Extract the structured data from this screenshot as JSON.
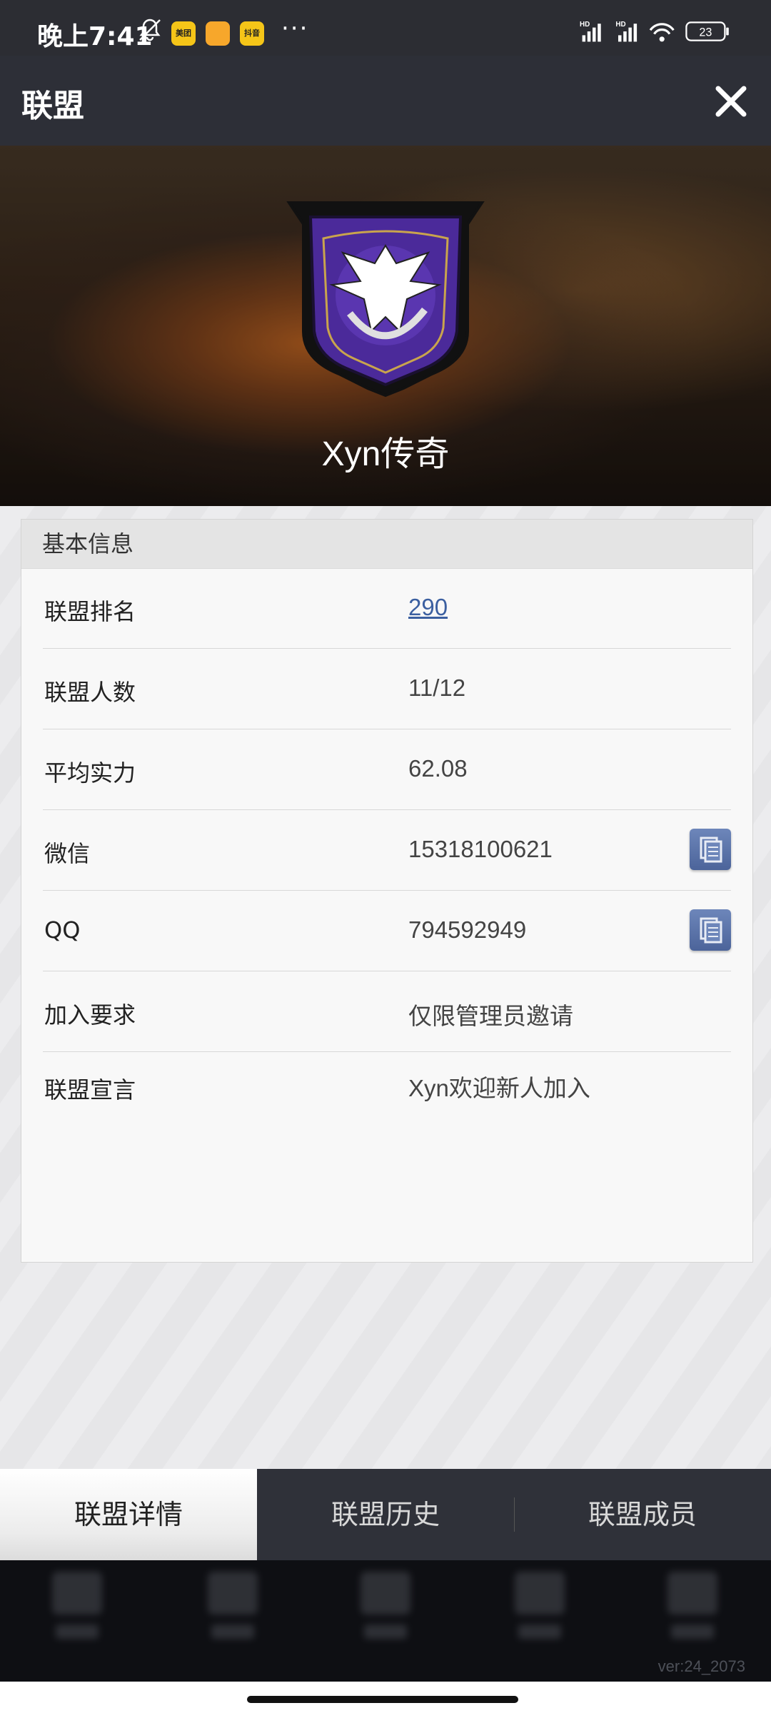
{
  "status_bar": {
    "time": "晚上7:41",
    "icons": [
      "bell-off-icon",
      "meituan-app-icon",
      "notes-app-icon",
      "app-icon",
      "more-dots-icon",
      "signal-hd-icon",
      "signal-hd-icon",
      "wifi-icon",
      "battery-icon"
    ],
    "battery": "23",
    "app_labels": [
      "美团",
      "",
      "抖音"
    ],
    "more": "···"
  },
  "header": {
    "title": "联盟",
    "close_icon": "close-icon"
  },
  "banner": {
    "alliance_name": "Xyn传奇",
    "emblem_color": "#4b2a9a"
  },
  "info_panel": {
    "title": "基本信息",
    "rows": [
      {
        "label": "联盟排名",
        "value": "290"
      },
      {
        "label": "联盟人数",
        "value": "11/12"
      },
      {
        "label": "平均实力",
        "value": "62.08"
      },
      {
        "label": "微信",
        "value": "15318100621"
      },
      {
        "label": "QQ",
        "value": "794592949"
      },
      {
        "label": "加入要求",
        "value": "仅限管理员邀请"
      },
      {
        "label": "联盟宣言",
        "value": "Xyn欢迎新人加入"
      }
    ]
  },
  "tabs": [
    {
      "label": "联盟详情",
      "active": true
    },
    {
      "label": "联盟历史",
      "active": false
    },
    {
      "label": "联盟成员",
      "active": false
    }
  ],
  "footer": {
    "version": "ver:24_2073"
  },
  "colors": {
    "accent_link": "#3b5fa0",
    "copy_button": "#5a72a8",
    "header_bg": "#2d2f37"
  }
}
